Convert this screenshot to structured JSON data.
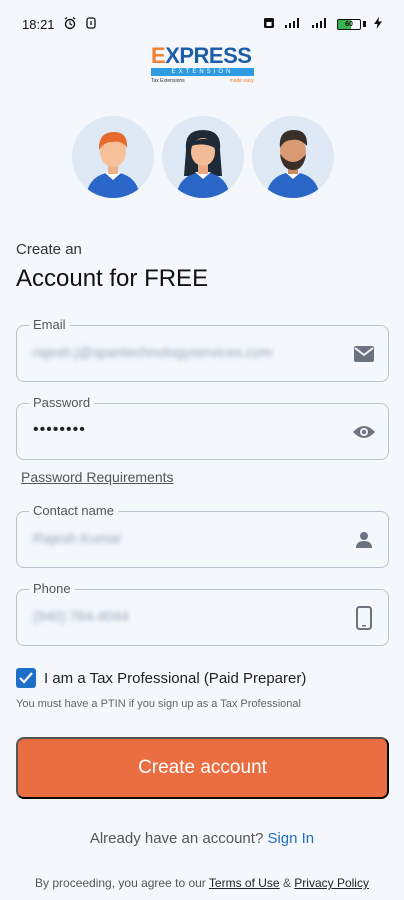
{
  "status_bar": {
    "time": "18:21",
    "battery_level": "60",
    "icons": [
      "alarm-icon",
      "sync-icon",
      "sim-icon",
      "signal-icon",
      "signal-icon",
      "battery-icon",
      "charging-icon"
    ]
  },
  "brand": {
    "main": "EXPRESS",
    "sub": "EXTENSION",
    "tag_left": "Tax Extensions",
    "tag_right": "made easy",
    "colors": {
      "blue": "#1e5ea8",
      "orange": "#f07f30",
      "light_blue": "#2f9be0"
    }
  },
  "heading": {
    "small": "Create an",
    "large": "Account for FREE"
  },
  "fields": {
    "email": {
      "label": "Email",
      "value": "rajesh.j@spantechnologyservices.com",
      "icon": "mail-icon"
    },
    "password": {
      "label": "Password",
      "value": "••••••••",
      "icon": "eye-icon"
    },
    "contact": {
      "label": "Contact name",
      "value": "Rajesh Kumar",
      "icon": "person-icon"
    },
    "phone": {
      "label": "Phone",
      "value": "(940) 764-4044",
      "icon": "phone-icon"
    }
  },
  "password_requirements": "Password Requirements",
  "tax_pro": {
    "checked": true,
    "label_prefix": "I am a ",
    "label_strong": "Tax Professional (Paid Preparer)",
    "note": "You must have a PTIN if you sign up as a Tax Professional"
  },
  "cta": {
    "label": "Create account",
    "color": "#eb6e42"
  },
  "signin": {
    "prompt": "Already have an account?",
    "link": "Sign In"
  },
  "footer": {
    "prefix": "By proceeding, you agree to our ",
    "terms": "Terms of Use",
    "and": " & ",
    "privacy": "Privacy Policy"
  }
}
